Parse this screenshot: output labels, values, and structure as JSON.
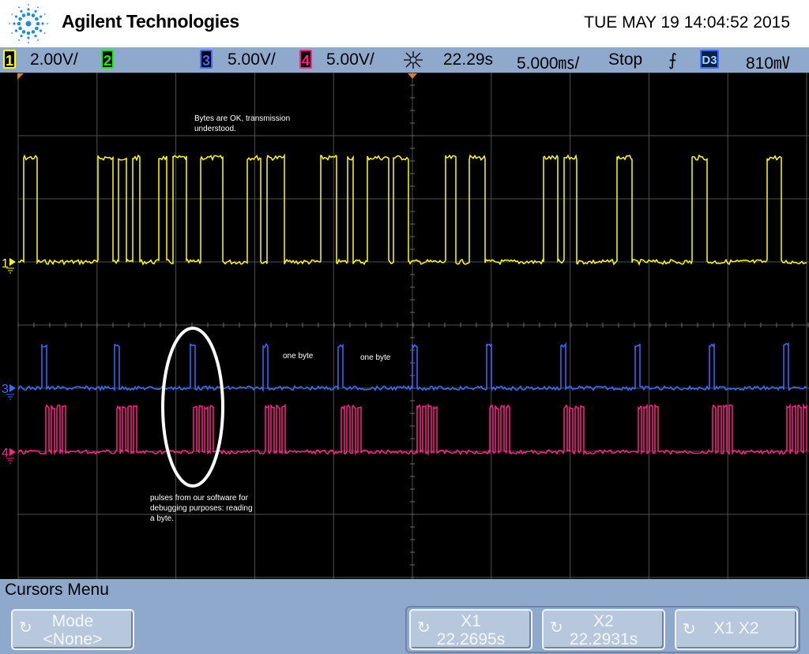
{
  "header": {
    "brand": "Agilent Technologies",
    "datetime": "TUE MAY 19 14:04:52 2015"
  },
  "status_bar": {
    "ch1": {
      "number": "1",
      "scale": "2.00V/",
      "color": "#ffff00"
    },
    "ch2": {
      "number": "2",
      "color": "#00ff00"
    },
    "ch3": {
      "number": "3",
      "scale": "5.00V/",
      "color": "#3a6cff"
    },
    "ch4": {
      "number": "4",
      "scale": "5.00V/",
      "color": "#ff2288"
    },
    "time_ref": "22.29s",
    "timebase": "5.000㎳/",
    "run_state": "Stop",
    "trigger_edge": "⨍",
    "trigger_source": "D3",
    "trigger_level": "810㎷"
  },
  "screen": {
    "annotations": {
      "bytes_ok": "Bytes are OK, transmission understood.",
      "one_byte_1": "one byte",
      "one_byte_2": "one byte",
      "pulses": "pulses from our software for debugging purposes: reading a byte."
    },
    "channel_markers": [
      "1",
      "3",
      "4"
    ]
  },
  "softkeys": {
    "menu_title": "Cursors Menu",
    "mode": {
      "label": "Mode",
      "value": "<None>"
    },
    "x1": {
      "label": "X1",
      "value": "22.2695s"
    },
    "x2": {
      "label": "X2",
      "value": "22.2931s"
    },
    "x1x2": {
      "label": "X1 X2"
    }
  }
}
